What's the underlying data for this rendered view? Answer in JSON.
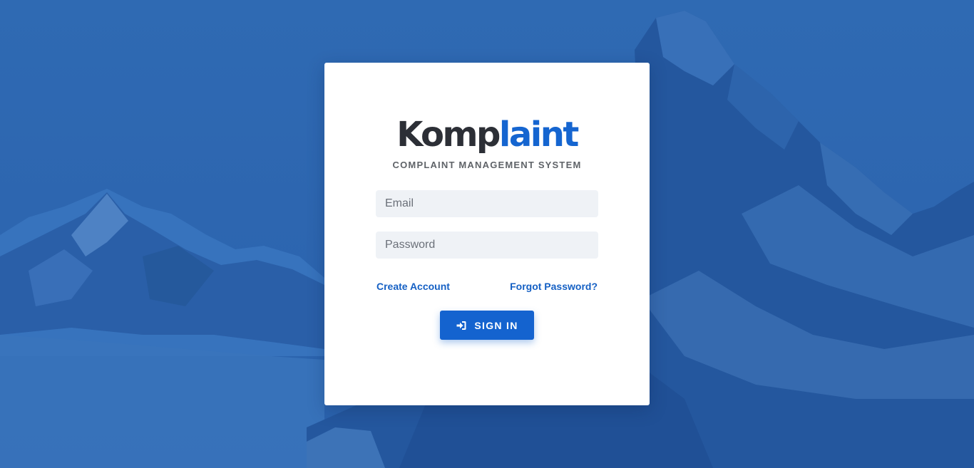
{
  "logo": {
    "part1": "Komp",
    "part2": "laint"
  },
  "subtitle": "COMPLAINT MANAGEMENT SYSTEM",
  "form": {
    "email_placeholder": "Email",
    "password_placeholder": "Password",
    "create_account_label": "Create Account",
    "forgot_password_label": "Forgot Password?",
    "sign_in_label": "SIGN IN",
    "sign_in_icon": "sign-in-icon"
  },
  "colors": {
    "accent": "#1463cf",
    "background": "#2d66b0",
    "logo_dark": "#2c2f36",
    "logo_blue": "#1565d0"
  }
}
